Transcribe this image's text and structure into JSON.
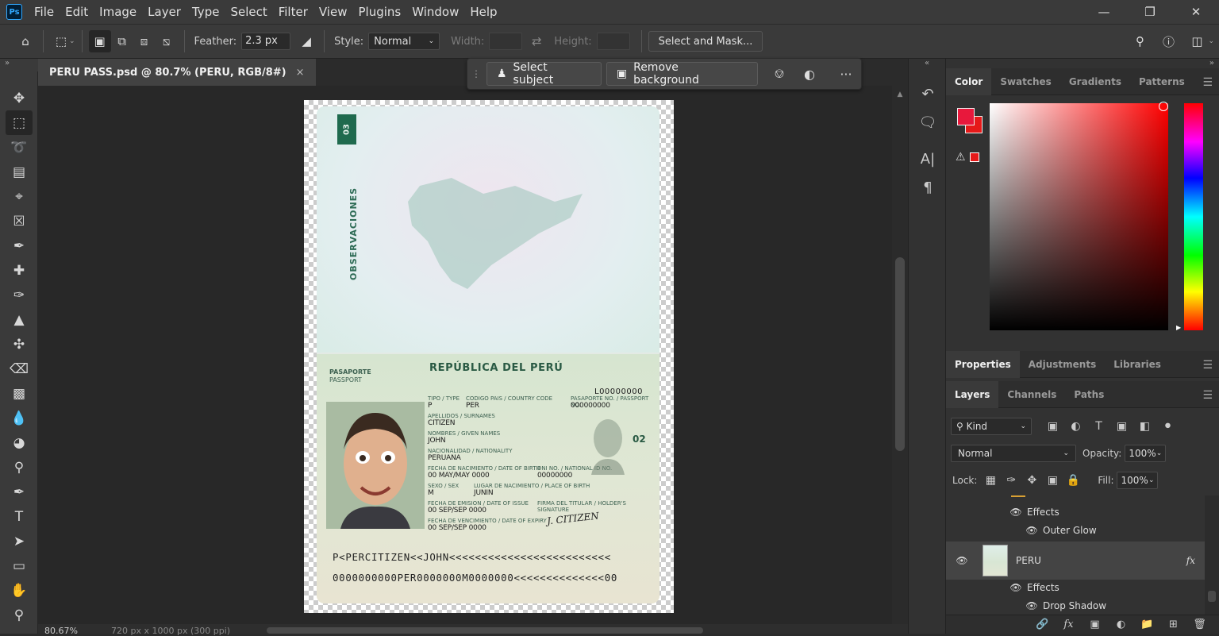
{
  "menu": {
    "logo": "Ps",
    "items": [
      "File",
      "Edit",
      "Image",
      "Layer",
      "Type",
      "Select",
      "Filter",
      "View",
      "Plugins",
      "Window",
      "Help"
    ],
    "window_controls": [
      "minimize-icon",
      "restore-icon",
      "close-icon"
    ]
  },
  "options": {
    "feather_label": "Feather:",
    "feather_value": "2.3 px",
    "style_label": "Style:",
    "style_value": "Normal",
    "width_label": "Width:",
    "height_label": "Height:",
    "select_mask": "Select and Mask..."
  },
  "document": {
    "tab_title": "PERU PASS.psd @ 80.7% (PERU, RGB/8#)",
    "tab_close": "×"
  },
  "context_bar": {
    "select_subject": "Select subject",
    "remove_background": "Remove background",
    "more": "···"
  },
  "passport": {
    "tab_number": "03",
    "observaciones": "OBSERVACIONES",
    "title": "REPÚBLICA DEL PERÚ",
    "doc_type_es": "PASAPORTE",
    "doc_type_en": "PASSPORT",
    "number_big": "L00000000",
    "lbl_type": "TIPO / TYPE",
    "lbl_country": "CODIGO PAIS / COUNTRY CODE",
    "lbl_passno": "PASAPORTE No. / PASSPORT No.",
    "val_type": "P",
    "val_country": "PER",
    "val_passno": "000000000",
    "lbl_surname": "APELLIDOS / SURNAMES",
    "val_surname": "CITIZEN",
    "lbl_given": "NOMBRES / GIVEN NAMES",
    "val_given": "JOHN",
    "lbl_nat": "NACIONALIDAD / NATIONALITY",
    "val_nat": "PERUANA",
    "lbl_dob": "FECHA DE NACIMIENTO / DATE OF BIRTH",
    "val_dob": "00 MAY/MAY 0000",
    "lbl_dni": "DNI No. / National ID No.",
    "val_dni": "00000000",
    "lbl_sex": "SEXO / SEX",
    "val_sex": "M",
    "lbl_pob": "LUGAR DE NACIMIENTO / PLACE OF BIRTH",
    "val_pob": "JUNIN",
    "lbl_issue": "FECHA DE EMISION / DATE OF ISSUE",
    "val_issue": "00 SEP/SEP 0000",
    "lbl_sig": "FIRMA DEL TITULAR / HOLDER'S SIGNATURE",
    "lbl_expiry": "FECHA DE VENCIMIENTO / DATE OF EXPIRY",
    "val_expiry": "00 SEP/SEP 0000",
    "ghost_number": "02",
    "signature": "J. CITIZEN",
    "mrz1": "P<PERCITIZEN<<JOHN<<<<<<<<<<<<<<<<<<<<<<<<<",
    "mrz2": "0000000000PER0000000M0000000<<<<<<<<<<<<<<00"
  },
  "status": {
    "zoom": "80.67%",
    "dims": "720 px x 1000 px (300 ppi)"
  },
  "color_panel": {
    "tabs": [
      "Color",
      "Swatches",
      "Gradients",
      "Patterns"
    ],
    "active": 0,
    "fg": "#e8183c",
    "bg": "#e61919"
  },
  "props_panel": {
    "tabs": [
      "Properties",
      "Adjustments",
      "Libraries"
    ],
    "active": 0
  },
  "layers_panel": {
    "tabs": [
      "Layers",
      "Channels",
      "Paths"
    ],
    "active": 0,
    "kind": "Kind",
    "blend": "Normal",
    "opacity_label": "Opacity:",
    "opacity": "100%",
    "lock_label": "Lock:",
    "fill_label": "Fill:",
    "fill": "100%",
    "rows": [
      {
        "name": "Effects"
      },
      {
        "name": "Outer Glow"
      },
      {
        "name": "PERU",
        "fx": "fx"
      },
      {
        "name": "Effects"
      },
      {
        "name": "Drop Shadow"
      }
    ]
  }
}
